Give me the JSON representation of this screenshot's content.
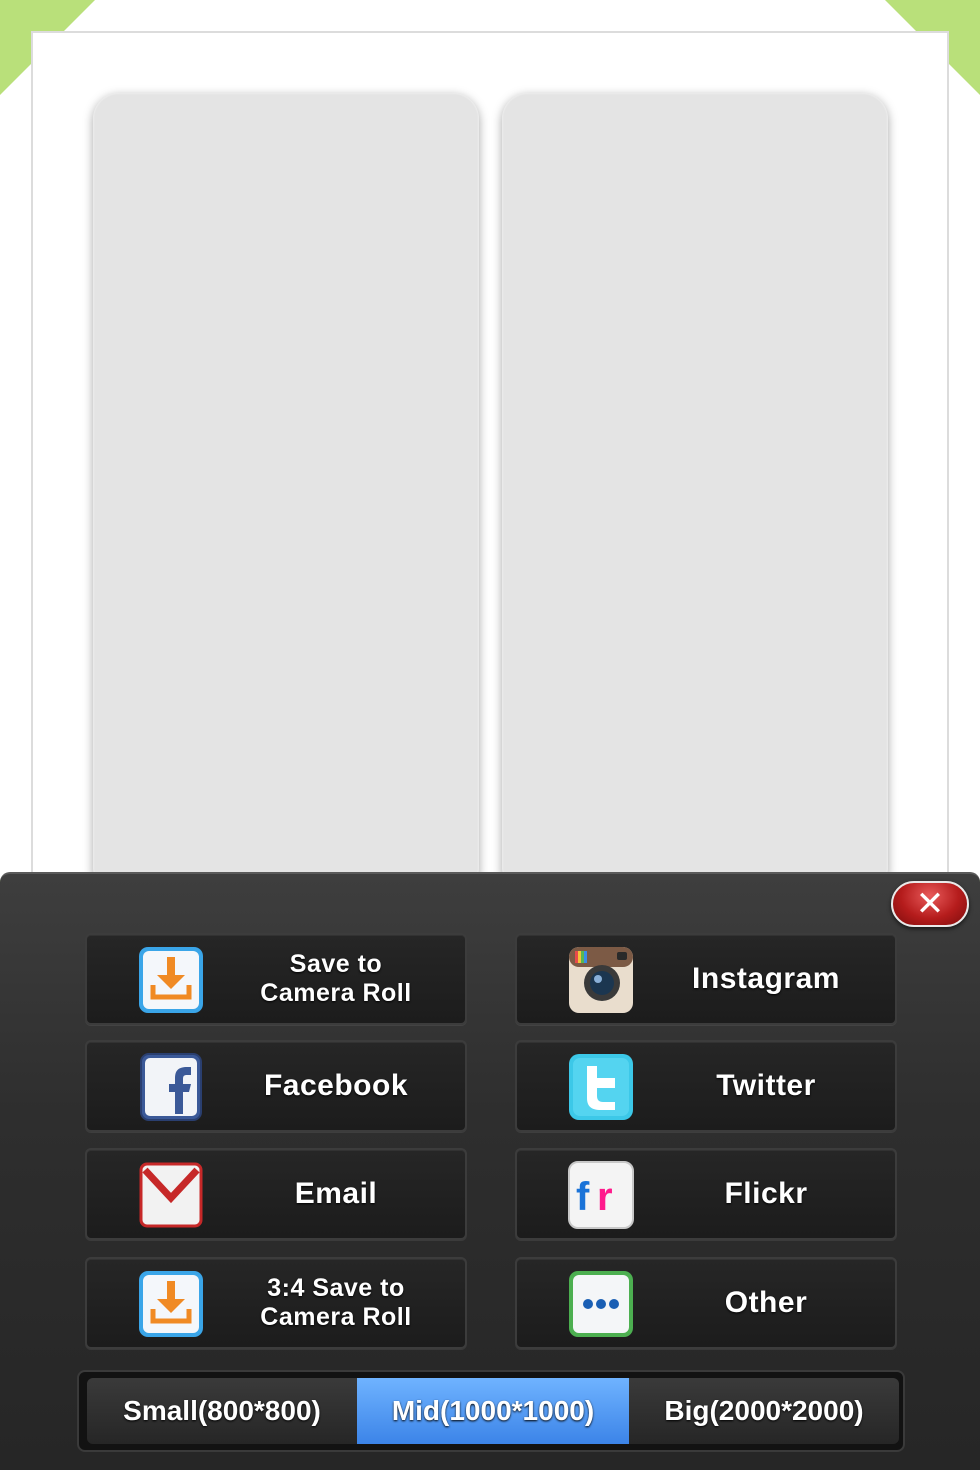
{
  "share_options": [
    {
      "label": "Save to\nCamera Roll",
      "icon": "download-icon"
    },
    {
      "label": "Instagram",
      "icon": "instagram-icon"
    },
    {
      "label": "Facebook",
      "icon": "facebook-icon"
    },
    {
      "label": "Twitter",
      "icon": "twitter-icon"
    },
    {
      "label": "Email",
      "icon": "email-icon"
    },
    {
      "label": "Flickr",
      "icon": "flickr-icon"
    },
    {
      "label": "3:4 Save to\nCamera Roll",
      "icon": "download-icon"
    },
    {
      "label": "Other",
      "icon": "more-icon"
    }
  ],
  "size_options": [
    {
      "label": "Small(800*800)",
      "selected": false
    },
    {
      "label": "Mid(1000*1000)",
      "selected": true
    },
    {
      "label": "Big(2000*2000)",
      "selected": false
    }
  ],
  "close_glyph": "✕",
  "colors": {
    "accent_green": "#b9e07a",
    "selected_blue": "#4a90f0",
    "close_red": "#b51c1c",
    "panel_dark": "#2e2e2e"
  }
}
